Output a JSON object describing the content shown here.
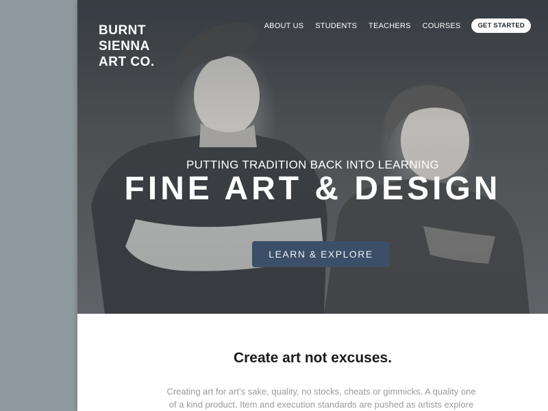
{
  "brand": {
    "lines": [
      "BURNT",
      "SIENNA",
      "ART CO."
    ]
  },
  "nav": {
    "items": [
      "ABOUT US",
      "STUDENTS",
      "TEACHERS",
      "COURSES"
    ],
    "cta_label": "GET STARTED"
  },
  "hero": {
    "tagline": "PUTTING TRADITION BACK INTO LEARNING",
    "headline": "FINE ART & DESIGN",
    "button_label": "LEARN & EXPLORE"
  },
  "content": {
    "heading": "Create art not excuses.",
    "body": "Creating art for art’s sake, quality, no stocks, cheats or gimmicks. A quality one of a kind product. Item and execution standards are pushed as artists explore both"
  },
  "colors": {
    "gutter": "#8d999c",
    "button": "#3b4f68",
    "heading": "#1a1a1a",
    "body_text": "#9a9a9a"
  }
}
